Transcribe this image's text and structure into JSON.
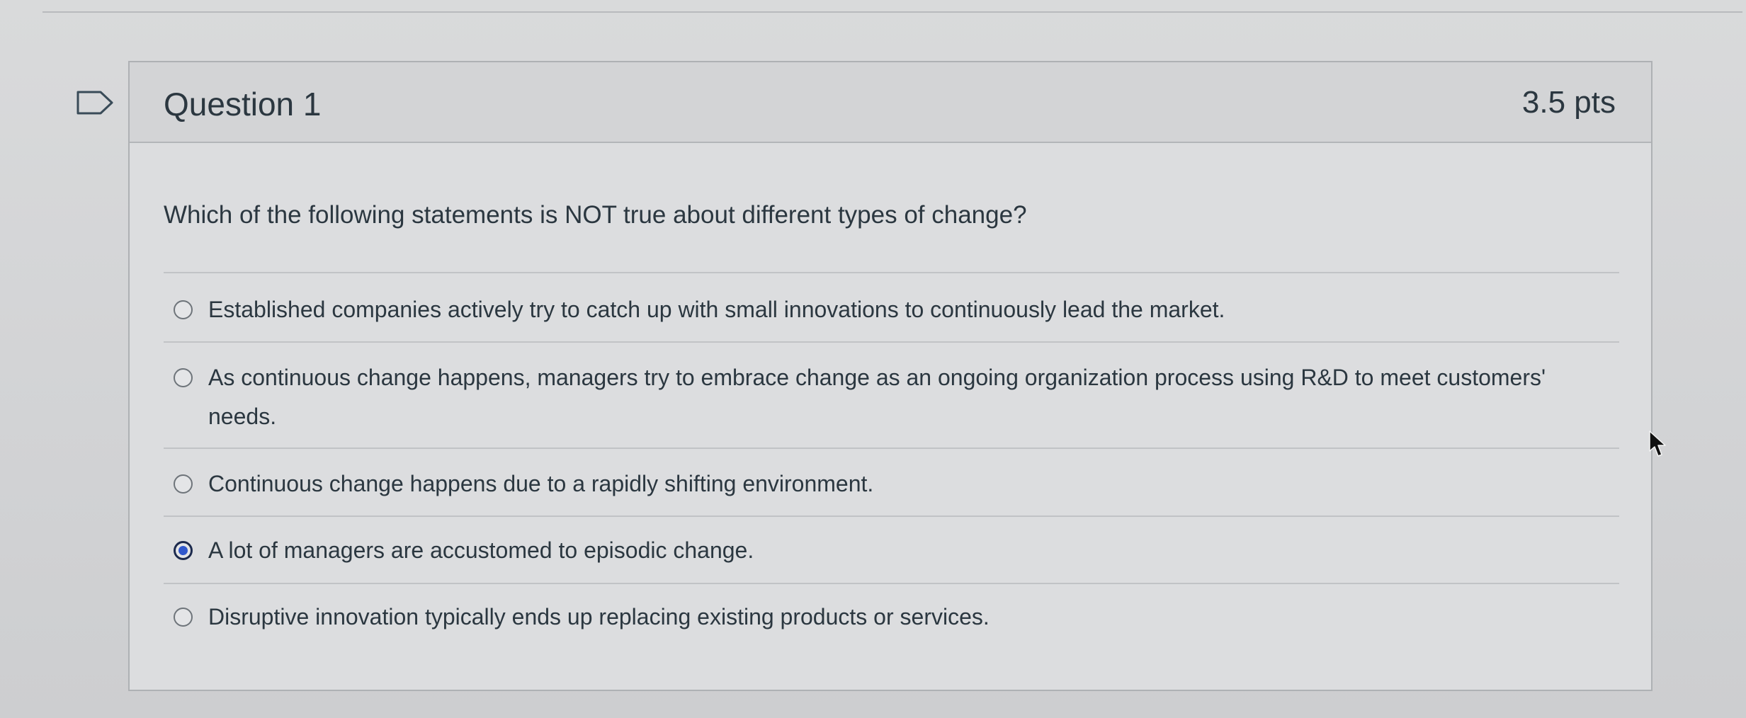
{
  "question": {
    "title": "Question 1",
    "points": "3.5 pts",
    "text": "Which of the following statements is NOT true about different types of change?",
    "flag_icon": "flag-outline-icon",
    "selected_index": 3,
    "answers": [
      {
        "label": "Established companies actively try to catch up with small innovations to continuously lead the market.",
        "selected": false
      },
      {
        "label": "As continuous change happens, managers try to embrace change as an ongoing organization process using R&D to meet customers' needs.",
        "selected": false
      },
      {
        "label": "Continuous change happens due to a rapidly shifting environment.",
        "selected": false
      },
      {
        "label": "A lot of managers are accustomed to episodic change.",
        "selected": true
      },
      {
        "label": "Disruptive innovation typically ends up replacing existing products or services.",
        "selected": false
      }
    ]
  },
  "colors": {
    "selected_radio_fill": "#3058cc",
    "text": "#2b3740",
    "header_background": "#d3d4d6"
  },
  "pointer_icon": "mouse-pointer-icon"
}
